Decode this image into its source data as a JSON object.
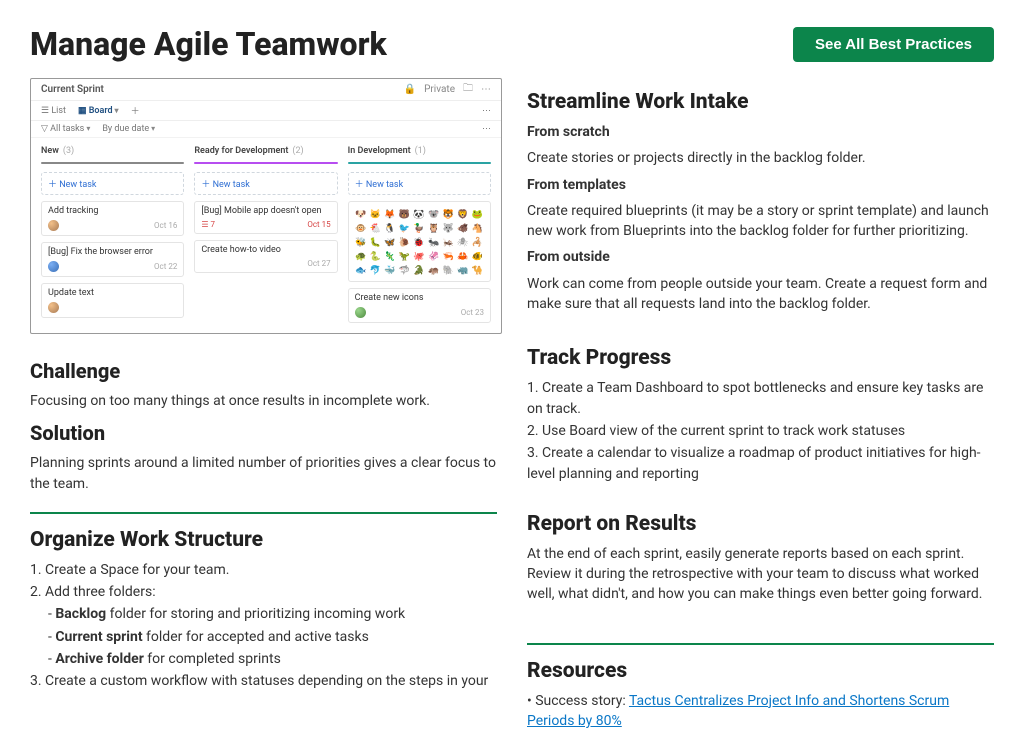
{
  "header": {
    "title": "Manage Agile Teamwork",
    "seeAll": "See All Best Practices"
  },
  "mockup": {
    "title": "Current Sprint",
    "privacy": "Private",
    "tabs": {
      "list": "List",
      "board": "Board"
    },
    "filter": {
      "allTasks": "All tasks",
      "dueDate": "By due date"
    },
    "lanes": [
      {
        "name": "New",
        "count": "(3)",
        "newTask": "New task",
        "cards": [
          {
            "title": "Add tracking",
            "date": "Oct 16"
          },
          {
            "title": "[Bug] Fix the browser error",
            "date": "Oct 22"
          },
          {
            "title": "Update text",
            "date": ""
          }
        ]
      },
      {
        "name": "Ready for Development",
        "count": "(2)",
        "newTask": "New task",
        "cards": [
          {
            "title": "[Bug] Mobile app doesn't open",
            "date": "Oct 15",
            "red": true,
            "sub": "7"
          },
          {
            "title": "Create how-to video",
            "date": "Oct 27"
          }
        ]
      },
      {
        "name": "In Development",
        "count": "(1)",
        "newTask": "New task",
        "cards": [
          {
            "title": "icon-grid"
          },
          {
            "title": "Create new icons",
            "date": "Oct 23"
          }
        ]
      }
    ]
  },
  "left": {
    "challengeH": "Challenge",
    "challengeP": "Focusing on too many things at once results in incomplete work.",
    "solutionH": "Solution",
    "solutionP": "Planning sprints around a limited number of priorities gives a clear focus to the team.",
    "organizeH": "Organize Work Structure",
    "organize": {
      "l1": "1. Create a Space for your team.",
      "l2": "2. Add three folders:",
      "b1pre": "- ",
      "b1b": "Backlog",
      "b1post": " folder for storing and prioritizing incoming work",
      "b2pre": "- ",
      "b2b": "Current sprint",
      "b2post": " folder for accepted and active tasks",
      "b3pre": "- ",
      "b3b": "Archive folder",
      "b3post": " for completed sprints",
      "l3": "3. Create a custom workflow with statuses depending on the steps in your"
    }
  },
  "right": {
    "streamlineH": "Streamline Work Intake",
    "s1t": "From scratch",
    "s1p": "Create stories or projects directly in the backlog folder.",
    "s2t": "From templates",
    "s2p": "Create required blueprints (it may be a story or sprint template) and launch new work from Blueprints into the backlog folder for further prioritizing.",
    "s3t": "From outside",
    "s3p": "Work can come from people outside your team. Create a request form and make sure that all requests land into the backlog folder.",
    "trackH": "Track Progress",
    "t1": "1. Create a Team Dashboard to spot bottlenecks and ensure key tasks are on track.",
    "t2": "2. Use Board view of the current sprint to track work statuses",
    "t3": "3. Create a calendar to visualize a roadmap of product initiatives for high-level planning and reporting",
    "reportH": "Report on Results",
    "reportP": "At the end of each sprint, easily generate reports based on each sprint. Review it during the retrospective with your team to discuss what worked well, what didn't, and how you can make things even better going forward.",
    "resourcesH": "Resources",
    "r1pre": "• Success story: ",
    "r1link": "Tactus Centralizes Project Info and Shortens Scrum Periods by 80%"
  }
}
